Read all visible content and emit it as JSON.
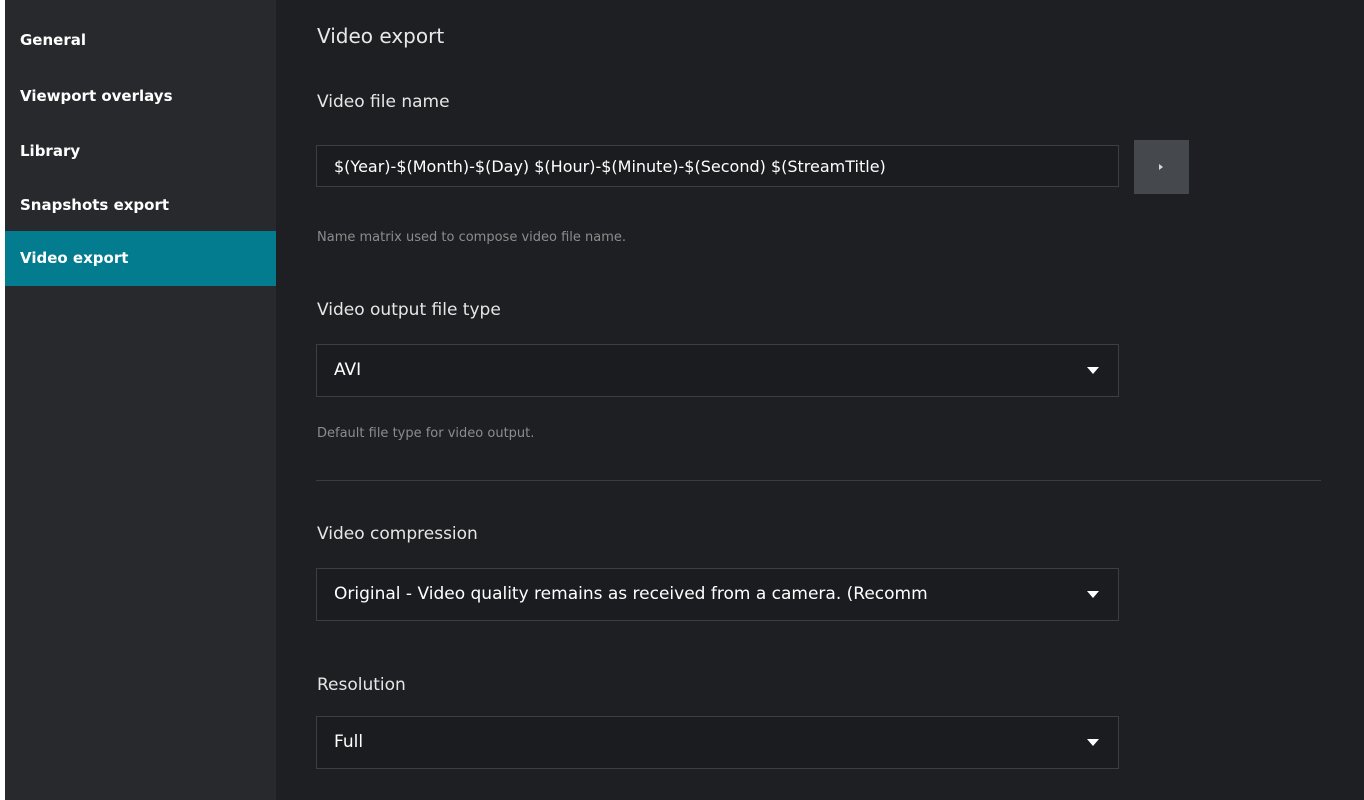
{
  "sidebar": {
    "items": [
      {
        "label": "General",
        "active": false
      },
      {
        "label": "Viewport overlays",
        "active": false
      },
      {
        "label": "Library",
        "active": false
      },
      {
        "label": "Snapshots export",
        "active": false
      },
      {
        "label": "Video export",
        "active": true
      }
    ]
  },
  "main": {
    "title": "Video export",
    "file_name": {
      "label": "Video file name",
      "value": "$(Year)-$(Month)-$(Day) $(Hour)-$(Minute)-$(Second) $(StreamTitle)",
      "hint": "Name matrix used to compose video file name."
    },
    "output_type": {
      "label": "Video output file type",
      "selected": "AVI",
      "hint": "Default file type for video output."
    },
    "compression": {
      "label": "Video compression",
      "selected": "Original - Video quality remains as received from a camera. (Recomm"
    },
    "resolution": {
      "label": "Resolution",
      "selected": "Full"
    }
  },
  "colors": {
    "accent": "#027c8e",
    "sidebar_bg": "#27292c",
    "content_bg": "#1e1f22"
  }
}
